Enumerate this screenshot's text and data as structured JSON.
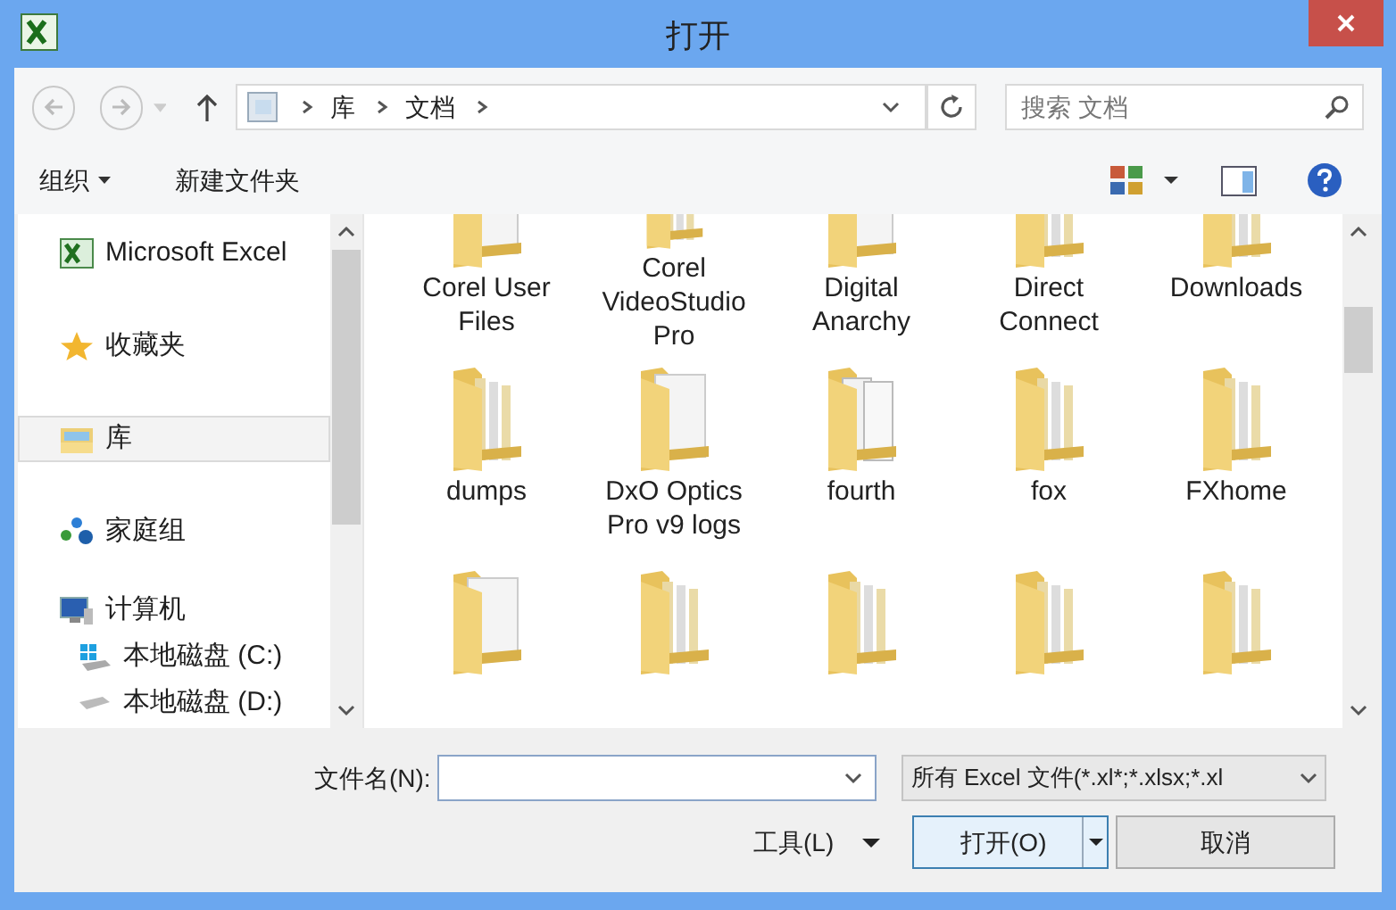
{
  "window": {
    "title": "打开"
  },
  "nav": {
    "breadcrumb": [
      "库",
      "文档"
    ],
    "search": {
      "placeholder": "搜索 文档"
    }
  },
  "toolbar": {
    "organize": "组织",
    "new_folder": "新建文件夹"
  },
  "sidebar": {
    "items": [
      {
        "kind": "app",
        "label": "Microsoft Excel",
        "selected": false
      },
      {
        "kind": "favorites",
        "label": "收藏夹",
        "selected": false
      },
      {
        "kind": "libraries",
        "label": "库",
        "selected": true
      },
      {
        "kind": "homegroup",
        "label": "家庭组",
        "selected": false
      },
      {
        "kind": "computer",
        "label": "计算机",
        "selected": false,
        "children": [
          {
            "kind": "system-drive",
            "label": "本地磁盘 (C:)",
            "selected": false
          },
          {
            "kind": "drive",
            "label": "本地磁盘 (D:)",
            "selected": false
          }
        ]
      }
    ]
  },
  "files": [
    {
      "name": "Corel User Files",
      "kind": "paper"
    },
    {
      "name": "Corel VideoStudio Pro",
      "kind": "files"
    },
    {
      "name": "Digital Anarchy",
      "kind": "paper"
    },
    {
      "name": "Direct Connect",
      "kind": "files"
    },
    {
      "name": "Downloads",
      "kind": "files"
    },
    {
      "name": "dumps",
      "kind": "files"
    },
    {
      "name": "DxO Optics Pro v9 logs",
      "kind": "paper"
    },
    {
      "name": "fourth",
      "kind": "papers"
    },
    {
      "name": "fox",
      "kind": "files"
    },
    {
      "name": "FXhome",
      "kind": "files"
    },
    {
      "kind": "paper"
    },
    {
      "kind": "files"
    },
    {
      "kind": "files"
    },
    {
      "kind": "files"
    },
    {
      "kind": "files"
    }
  ],
  "footer": {
    "filename_label": "文件名(N):",
    "filter": "所有 Excel 文件(*.xl*;*.xlsx;*.xl",
    "tools": "工具(L)",
    "open": "打开(O)",
    "cancel": "取消"
  }
}
